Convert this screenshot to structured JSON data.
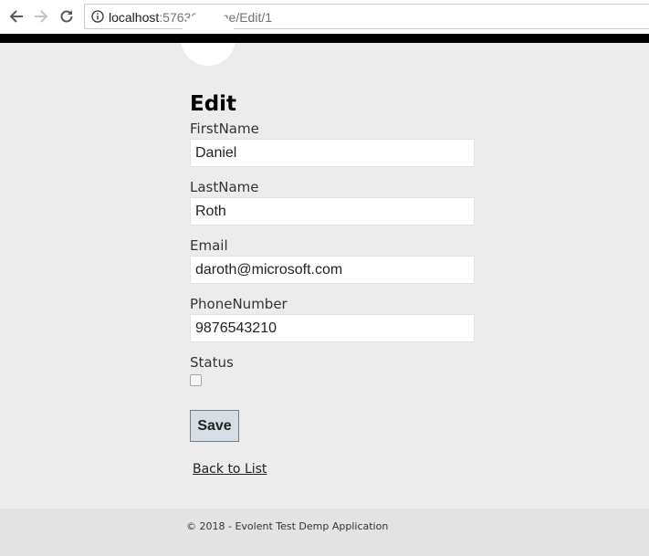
{
  "browser": {
    "url_host": "localhost",
    "url_path": ":57636/Home/Edit/1",
    "back_icon": "arrow-left-icon",
    "forward_icon": "arrow-right-icon",
    "reload_icon": "reload-icon",
    "info_icon": "info-icon"
  },
  "page": {
    "title": "Edit"
  },
  "form": {
    "fields": [
      {
        "label": "FirstName",
        "value": "Daniel"
      },
      {
        "label": "LastName",
        "value": "Roth"
      },
      {
        "label": "Email",
        "value": "daroth@microsoft.com"
      },
      {
        "label": "PhoneNumber",
        "value": "9876543210"
      }
    ],
    "status": {
      "label": "Status",
      "checked": false
    },
    "save_label": "Save",
    "back_link": "Back to List"
  },
  "footer": {
    "text": "© 2018 - Evolent Test Demp Application"
  }
}
